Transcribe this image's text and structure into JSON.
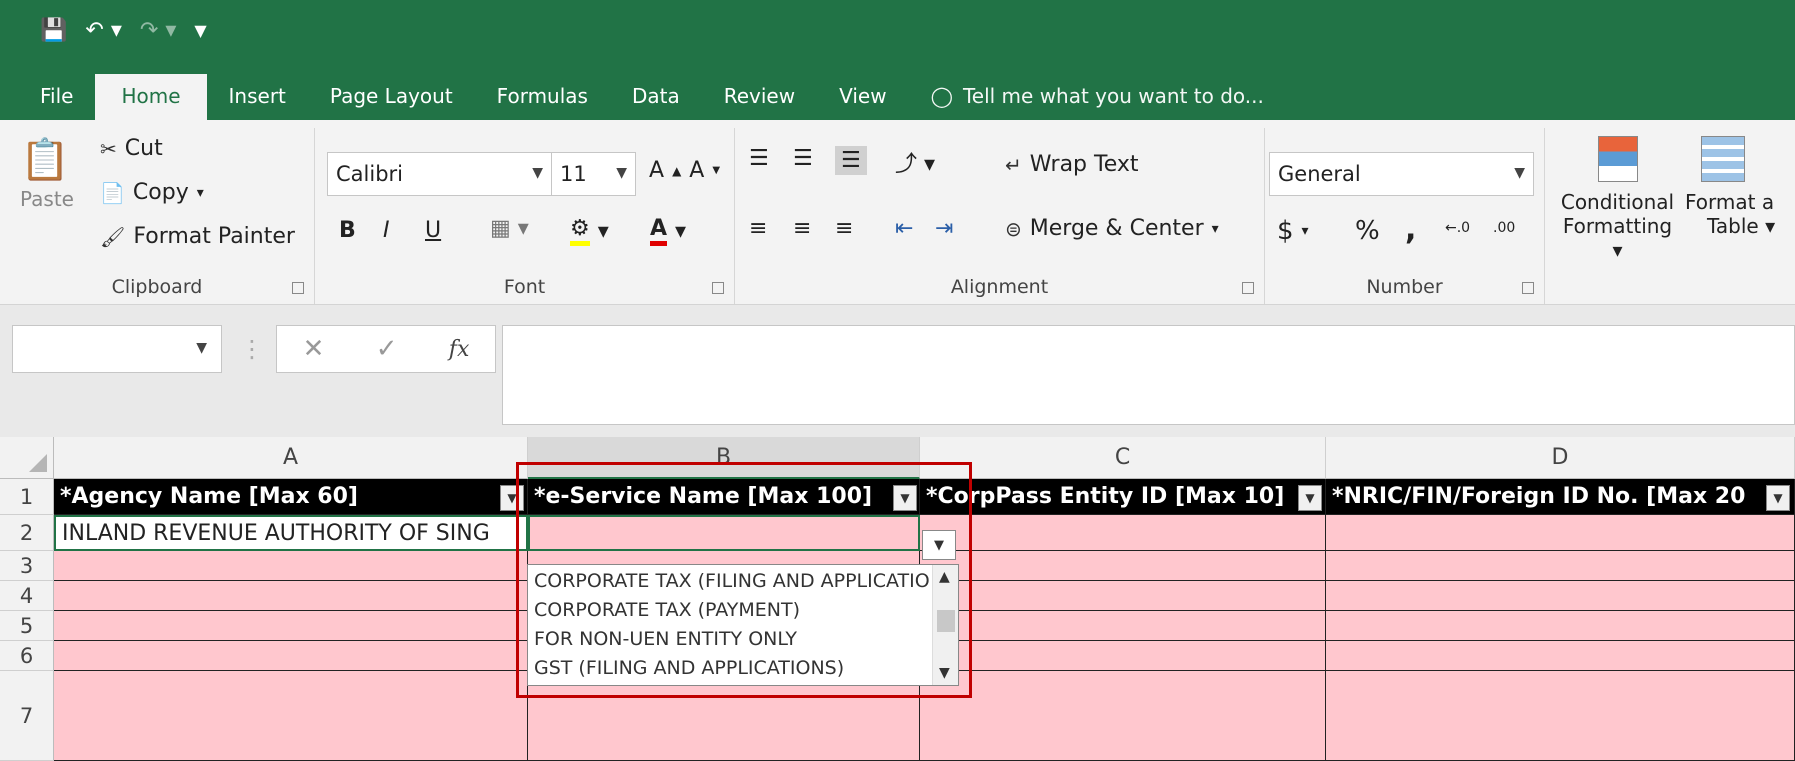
{
  "qat": {
    "save_icon": "save-icon",
    "undo_icon": "undo-icon",
    "redo_icon": "redo-icon",
    "customize_icon": "customize-qat-icon"
  },
  "tabs": [
    {
      "label": "File",
      "active": false
    },
    {
      "label": "Home",
      "active": true
    },
    {
      "label": "Insert",
      "active": false
    },
    {
      "label": "Page Layout",
      "active": false
    },
    {
      "label": "Formulas",
      "active": false
    },
    {
      "label": "Data",
      "active": false
    },
    {
      "label": "Review",
      "active": false
    },
    {
      "label": "View",
      "active": false
    }
  ],
  "tell_me": "Tell me what you want to do...",
  "ribbon": {
    "clipboard": {
      "paste": "Paste",
      "cut": "Cut",
      "copy": "Copy",
      "format_painter": "Format Painter",
      "label": "Clipboard"
    },
    "font": {
      "family": "Calibri",
      "size": "11",
      "label": "Font",
      "bold": "B",
      "italic": "I",
      "underline": "U"
    },
    "alignment": {
      "wrap": "Wrap Text",
      "merge": "Merge & Center",
      "label": "Alignment"
    },
    "number": {
      "format": "General",
      "currency": "$",
      "percent": "%",
      "comma": ",",
      "label": "Number"
    },
    "styles": {
      "conditional_line1": "Conditional",
      "conditional_line2": "Formatting",
      "table_line1": "Format a",
      "table_line2": "Table"
    }
  },
  "formula_bar": {
    "name_box": "",
    "cancel": "✕",
    "enter": "✓",
    "fx": "fx",
    "value": ""
  },
  "columns": [
    {
      "letter": "A",
      "selected": false
    },
    {
      "letter": "B",
      "selected": true
    },
    {
      "letter": "C",
      "selected": false
    },
    {
      "letter": "D",
      "selected": false
    }
  ],
  "rows": [
    "1",
    "2",
    "3",
    "4",
    "5",
    "6",
    "7"
  ],
  "header_row": [
    "*Agency Name [Max 60]",
    "*e-Service Name [Max 100]",
    "*CorpPass Entity ID [Max 10]",
    "*NRIC/FIN/Foreign ID No. [Max 20"
  ],
  "row2": {
    "A": "INLAND REVENUE AUTHORITY OF SING",
    "B": ""
  },
  "dropdown_options": [
    "CORPORATE TAX (FILING AND APPLICATIO",
    "CORPORATE TAX (PAYMENT)",
    "FOR NON-UEN ENTITY ONLY",
    "GST (FILING AND APPLICATIONS)"
  ],
  "colors": {
    "brand": "#217346",
    "highlight": "#ffc7ce",
    "callout": "#c00000"
  }
}
